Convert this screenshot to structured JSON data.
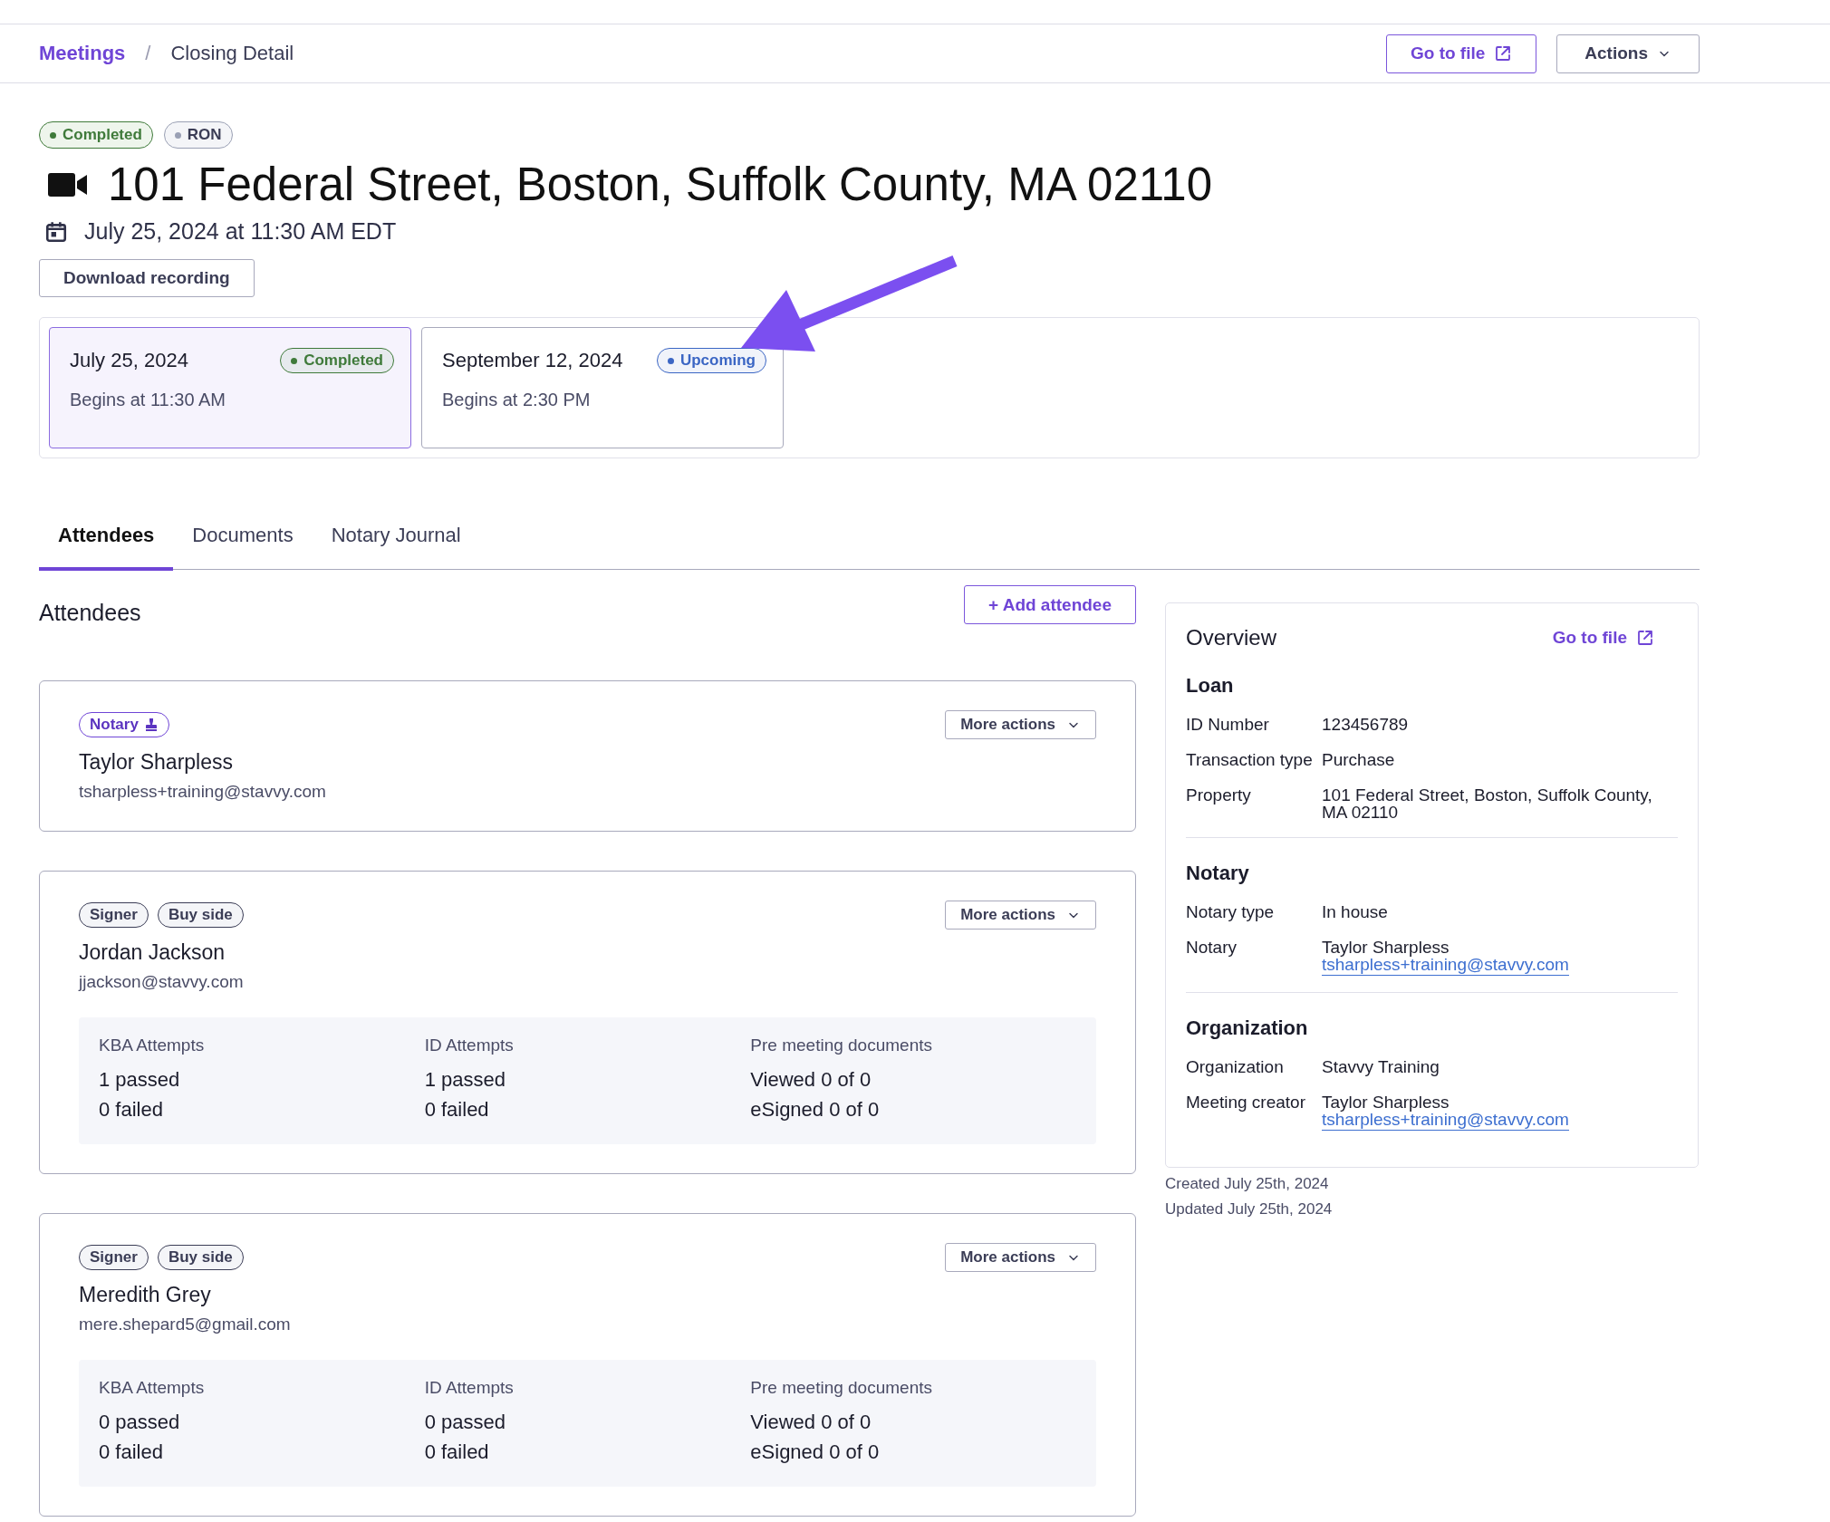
{
  "breadcrumb": [
    {
      "label": "Meetings",
      "kind": "link"
    },
    {
      "label": "/",
      "kind": "separator"
    },
    {
      "label": "Closing Detail",
      "kind": "current"
    }
  ],
  "header_buttons": [
    {
      "label": "Go to file",
      "kind": "external"
    },
    {
      "label": "Actions",
      "kind": "menu"
    }
  ],
  "badges": [
    {
      "label": "Completed",
      "color": "#3f7a3a"
    },
    {
      "label": "RON",
      "color": "#9aa0b4"
    }
  ],
  "title": "101 Federal Street, Boston, Suffolk County, MA 02110",
  "date_line": "July 25, 2024 at 11:30 AM EDT",
  "download_button": "Download recording",
  "sessions": [
    {
      "date": "July 25, 2024",
      "status": {
        "label": "Completed",
        "color": "#3f7a3a"
      },
      "begins": "Begins at 11:30 AM",
      "selected": true
    },
    {
      "date": "September 12, 2024",
      "status": {
        "label": "Upcoming",
        "color": "#3b66c4"
      },
      "begins": "Begins at 2:30 PM",
      "selected": false
    }
  ],
  "tabs": [
    {
      "label": "Attendees",
      "selected": true
    },
    {
      "label": "Documents",
      "selected": false
    },
    {
      "label": "Notary Journal",
      "selected": false
    }
  ],
  "attendees_heading": "Attendees",
  "add_button": "+ Add attendee",
  "attendees": [
    {
      "tags": [
        {
          "label": "Notary",
          "kind": "notary"
        }
      ],
      "name": "Taylor Sharpless",
      "email": "tsharpless+training@stavvy.com",
      "more_actions": "More actions"
    },
    {
      "tags": [
        {
          "label": "Signer",
          "kind": "plain"
        },
        {
          "label": "Buy side",
          "kind": "plain"
        }
      ],
      "name": "Jordan Jackson",
      "email": "jjackson@stavvy.com",
      "more_actions": "More actions",
      "stats": [
        {
          "heading": "KBA Attempts",
          "lines": [
            "1 passed",
            "0 failed"
          ]
        },
        {
          "heading": "ID Attempts",
          "lines": [
            "1 passed",
            "0 failed"
          ]
        },
        {
          "heading": "Pre meeting documents",
          "lines": [
            "Viewed 0 of 0",
            "eSigned 0 of 0"
          ]
        }
      ]
    },
    {
      "tags": [
        {
          "label": "Signer",
          "kind": "plain"
        },
        {
          "label": "Buy side",
          "kind": "plain"
        }
      ],
      "name": "Meredith Grey",
      "email": "mere.shepard5@gmail.com",
      "more_actions": "More actions",
      "stats": [
        {
          "heading": "KBA Attempts",
          "lines": [
            "0 passed",
            "0 failed"
          ]
        },
        {
          "heading": "ID Attempts",
          "lines": [
            "0 passed",
            "0 failed"
          ]
        },
        {
          "heading": "Pre meeting documents",
          "lines": [
            "Viewed 0 of 0",
            "eSigned 0 of 0"
          ]
        }
      ]
    }
  ],
  "overview": {
    "title": "Overview",
    "link": "Go to file",
    "sections": [
      {
        "title": "Loan",
        "rows": [
          {
            "label": "ID Number",
            "value": "123456789"
          },
          {
            "label": "Transaction type",
            "value": "Purchase"
          },
          {
            "label": "Property",
            "value": "101 Federal Street, Boston, Suffolk County, MA 02110"
          }
        ]
      },
      {
        "title": "Notary",
        "rows": [
          {
            "label": "Notary type",
            "value": "In house"
          },
          {
            "label": "Notary",
            "value": "Taylor Sharpless",
            "email": "tsharpless+training@stavvy.com"
          }
        ]
      },
      {
        "title": "Organization",
        "rows": [
          {
            "label": "Organization",
            "value": "Stavvy Training"
          },
          {
            "label": "Meeting creator",
            "value": "Taylor Sharpless",
            "email": "tsharpless+training@stavvy.com"
          }
        ]
      }
    ]
  },
  "created": "Created July 25th, 2024",
  "updated": "Updated July 25th, 2024"
}
